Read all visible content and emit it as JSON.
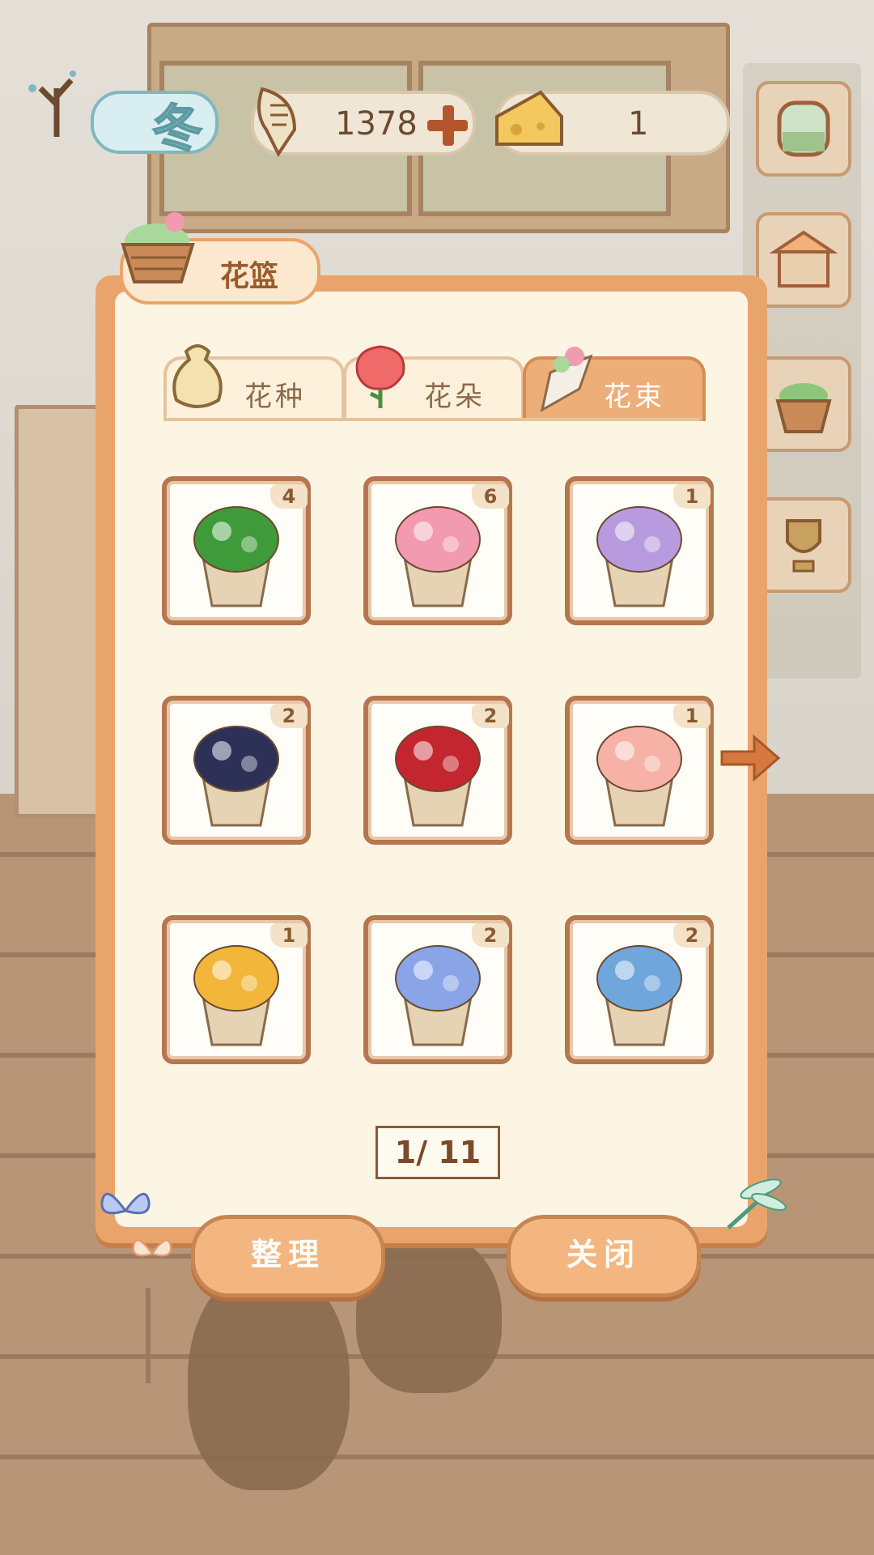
{
  "hud": {
    "season": "冬",
    "fish_currency": "1378",
    "cheese_currency": "1"
  },
  "panel": {
    "title": "花篮",
    "tabs": [
      {
        "label": "花种",
        "icon": "seed-bag-icon",
        "active": false
      },
      {
        "label": "花朵",
        "icon": "rose-icon",
        "active": false
      },
      {
        "label": "花束",
        "icon": "bouquet-icon",
        "active": true
      }
    ],
    "items": [
      {
        "name": "green-bouquet",
        "count": "4",
        "color": "#3f9a3a"
      },
      {
        "name": "pink-bouquet",
        "count": "6",
        "color": "#f29ab0"
      },
      {
        "name": "basket-bouquet",
        "count": "1",
        "color": "#b79bde"
      },
      {
        "name": "navy-bouquet",
        "count": "2",
        "color": "#2d3158"
      },
      {
        "name": "red-rose-bouquet",
        "count": "2",
        "color": "#c3262e"
      },
      {
        "name": "pastel-bouquet",
        "count": "1",
        "color": "#f6b2a6"
      },
      {
        "name": "yellow-bouquet",
        "count": "1",
        "color": "#f2b63a"
      },
      {
        "name": "lily-bouquet",
        "count": "2",
        "color": "#8aa4e8"
      },
      {
        "name": "hydrangea-pot",
        "count": "2",
        "color": "#6fa6dc"
      }
    ],
    "page": "1/ 11",
    "sort_button": "整理",
    "close_button": "关闭"
  },
  "colors": {
    "panel_border": "#e9a46c",
    "panel_bg": "#fdf5e4",
    "cell_border": "#b57650",
    "active_tab": "#eeae77"
  }
}
